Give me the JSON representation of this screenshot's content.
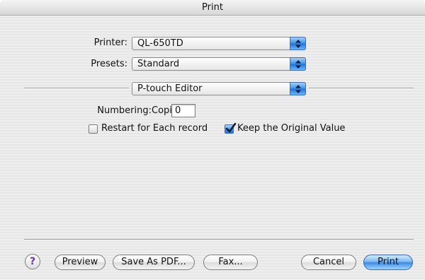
{
  "window": {
    "title": "Print"
  },
  "printer": {
    "label": "Printer:",
    "value": "QL-650TD"
  },
  "presets": {
    "label": "Presets:",
    "value": "Standard"
  },
  "panel": {
    "value": "P-touch Editor"
  },
  "numbering": {
    "label": "Numbering:",
    "copies_label": "Copies",
    "copies_value": "0",
    "restart_label": "Restart for Each record",
    "restart_checked": false,
    "keep_label": "Keep the Original Value",
    "keep_checked": true
  },
  "buttons": {
    "help": "?",
    "preview": "Preview",
    "save_pdf": "Save As PDF...",
    "fax": "Fax...",
    "cancel": "Cancel",
    "print": "Print"
  },
  "colors": {
    "accent": "#3b8be3",
    "help_glyph": "#6a2fb0"
  },
  "icons": [
    "popup-arrows-icon",
    "checkmark-icon",
    "help-icon"
  ]
}
